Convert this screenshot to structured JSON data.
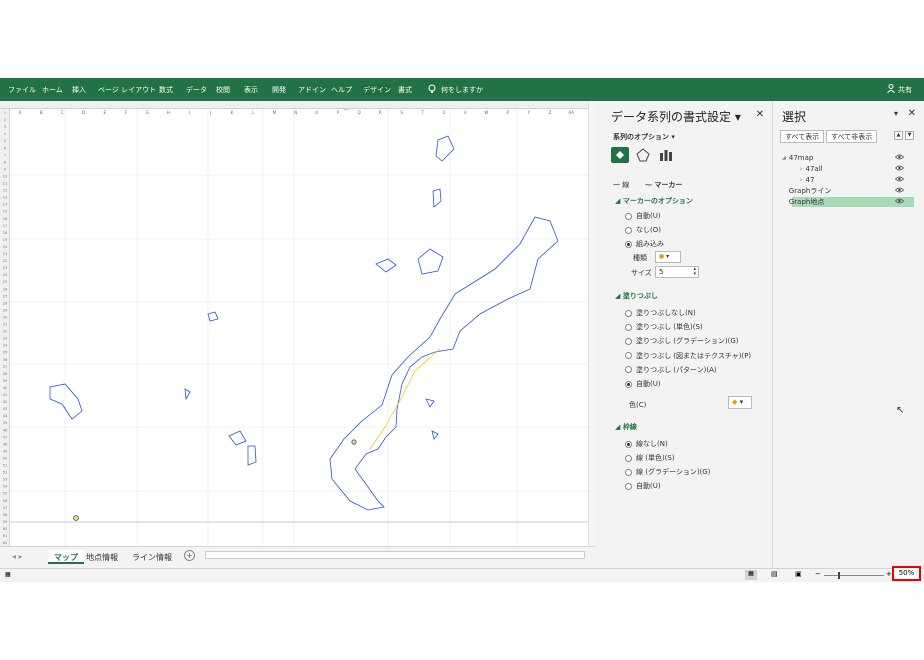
{
  "ribbon": {
    "tabs": [
      "ファイル",
      "ホーム",
      "挿入",
      "ページ レイアウト",
      "数式",
      "データ",
      "校閲",
      "表示",
      "開発",
      "アドイン",
      "ヘルプ",
      "デザイン",
      "書式"
    ],
    "active_tab": "デザイン",
    "tellme": "何をしますか",
    "share": "共有",
    "accent_color": "#217346"
  },
  "sheet": {
    "columns": [
      "A",
      "B",
      "C",
      "D",
      "E",
      "F",
      "G",
      "H",
      "I",
      "J",
      "K",
      "L",
      "M",
      "N",
      "O",
      "P",
      "Q",
      "R",
      "S",
      "T",
      "U",
      "V",
      "W",
      "X",
      "Y",
      "Z",
      "AA"
    ],
    "row_count": 62
  },
  "sheet_tabs": [
    "マップ",
    "地点情報",
    "ライン情報"
  ],
  "active_sheet": "マップ",
  "format_pane": {
    "title": "データ系列の書式設定",
    "series_options": "系列のオプション",
    "sub_tabs": [
      "線",
      "マーカー"
    ],
    "marker_section": "マーカーのオプション",
    "marker_options": [
      {
        "label": "自動(U)",
        "on": false
      },
      {
        "label": "なし(O)",
        "on": false
      },
      {
        "label": "組み込み",
        "on": true
      }
    ],
    "type_label": "種類",
    "size_label": "サイズ",
    "size_value": "5",
    "fill_section": "塗りつぶし",
    "fill_options": [
      {
        "label": "塗りつぶしなし(N)",
        "on": false
      },
      {
        "label": "塗りつぶし (単色)(S)",
        "on": false
      },
      {
        "label": "塗りつぶし (グラデーション)(G)",
        "on": false
      },
      {
        "label": "塗りつぶし (図またはテクスチャ)(P)",
        "on": false
      },
      {
        "label": "塗りつぶし (パターン)(A)",
        "on": false
      },
      {
        "label": "自動(U)",
        "on": true
      }
    ],
    "color_label": "色(C)",
    "border_section": "枠線",
    "border_options": [
      {
        "label": "線なし(N)",
        "on": true
      },
      {
        "label": "線 (単色)(S)",
        "on": false
      },
      {
        "label": "線 (グラデーション)(G)",
        "on": false
      },
      {
        "label": "自動(U)",
        "on": false
      }
    ]
  },
  "selection_pane": {
    "title": "選択",
    "show_all": "すべて表示",
    "hide_all": "すべて非表示",
    "items": [
      {
        "label": "47map",
        "indent": 0,
        "selected": false
      },
      {
        "label": "47all",
        "indent": 1,
        "selected": false
      },
      {
        "label": "47",
        "indent": 1,
        "selected": false
      },
      {
        "label": "Graphライン",
        "indent": 0,
        "selected": false
      },
      {
        "label": "Graph地点",
        "indent": 0,
        "selected": true
      }
    ]
  },
  "status": {
    "zoom": "50%"
  }
}
